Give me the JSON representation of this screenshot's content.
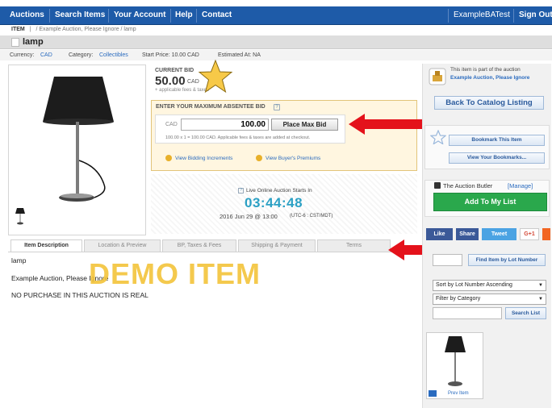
{
  "nav": {
    "items": [
      "Auctions",
      "Search Items",
      "Your Account",
      "Help",
      "Contact"
    ],
    "user": "ExampleBATest",
    "signout": "Sign Out"
  },
  "breadcrumb": {
    "item_label": "ITEM",
    "sep": "|",
    "path": "/ Example Auction, Please Ignore / lamp"
  },
  "title": "lamp",
  "meta": {
    "currency_label": "Currency:",
    "currency": "CAD",
    "category_label": "Category:",
    "category": "Collectibles",
    "start_price": "Start Price: 10.00 CAD",
    "estimated": "Estimated At: NA"
  },
  "bid": {
    "current_label": "CURRENT BID",
    "amount": "50.00",
    "currency": "CAD",
    "fees_note": "+ applicable fees & taxes",
    "absentee_label": "ENTER YOUR MAXIMUM ABSENTEE BID",
    "input_prefix": "CAD",
    "input_value": "100.00",
    "place_button": "Place Max Bid",
    "calc_note": "100.00 x 1 = 100.00 CAD. Applicable fees & taxes are added at checkout.",
    "link_increments": "View Bidding Increments",
    "link_premiums": "View Buyer's Premiums"
  },
  "live": {
    "label": "Live Online Auction Starts In",
    "countdown": "03:44:48",
    "date": "2016 Jun 29 @ 13:00",
    "tz": "(UTC-6 : CST/MDT)"
  },
  "tabs": [
    "Item Description",
    "Location & Preview",
    "BP, Taxes & Fees",
    "Shipping & Payment",
    "Terms"
  ],
  "description": {
    "lines": [
      "lamp",
      "Example Auction, Please Ignore",
      "NO PURCHASE IN THIS AUCTION IS REAL"
    ],
    "watermark": "DEMO ITEM"
  },
  "sidebar": {
    "part_of": "This item is part of the auction",
    "auction_name": "Example Auction, Please Ignore",
    "back_button": "Back To Catalog Listing",
    "bookmark": "Bookmark This Item",
    "view_bookmarks": "View Your Bookmarks...",
    "butler_title": "The Auction Butler",
    "butler_manage": "[Manage]",
    "add_button": "Add To My List",
    "social": [
      "Like",
      "Share",
      "Tweet",
      "G+1"
    ],
    "find_button": "Find Item by Lot Number",
    "sort_select": "Sort by Lot Number Ascending",
    "filter_select": "Filter by Category",
    "search_button": "Search List",
    "prev_item": "Prev Item"
  },
  "colors": {
    "nav": "#1e5ba8",
    "countdown": "#2ba0c4",
    "green": "#2aa84c",
    "watermark": "#f3c43a",
    "arrow": "#e4121b",
    "star": "#f7c948"
  }
}
